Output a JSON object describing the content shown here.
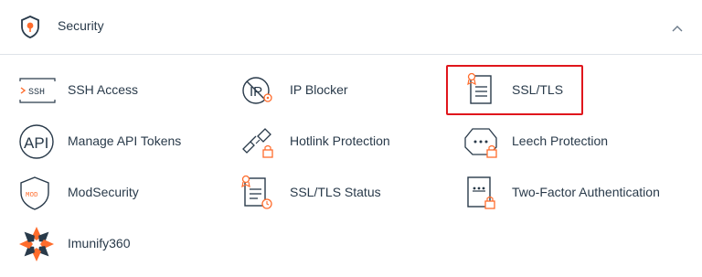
{
  "section": {
    "title": "Security",
    "icon": "security-shield-icon",
    "collapse_icon": "chevron-up-icon"
  },
  "tools": [
    {
      "label": "SSH Access",
      "icon": "ssh-terminal-icon"
    },
    {
      "label": "IP Blocker",
      "icon": "ip-blocker-icon"
    },
    {
      "label": "SSL/TLS",
      "icon": "ssl-certificate-icon"
    },
    {
      "label": "Manage API Tokens",
      "icon": "api-icon"
    },
    {
      "label": "Hotlink Protection",
      "icon": "broken-chain-lock-icon"
    },
    {
      "label": "Leech Protection",
      "icon": "chat-lock-icon"
    },
    {
      "label": "ModSecurity",
      "icon": "mod-shield-icon"
    },
    {
      "label": "SSL/TLS Status",
      "icon": "ssl-status-clock-icon"
    },
    {
      "label": "Two-Factor Authentication",
      "icon": "two-factor-lock-icon"
    },
    {
      "label": "Imunify360",
      "icon": "imunify360-logo-icon"
    }
  ],
  "highlighted_tool": "SSL/TLS",
  "colors": {
    "icon_dark": "#293a4a",
    "icon_accent": "#ff6c2c",
    "highlight_border": "#e0161c",
    "divider": "#dfe3e8"
  }
}
